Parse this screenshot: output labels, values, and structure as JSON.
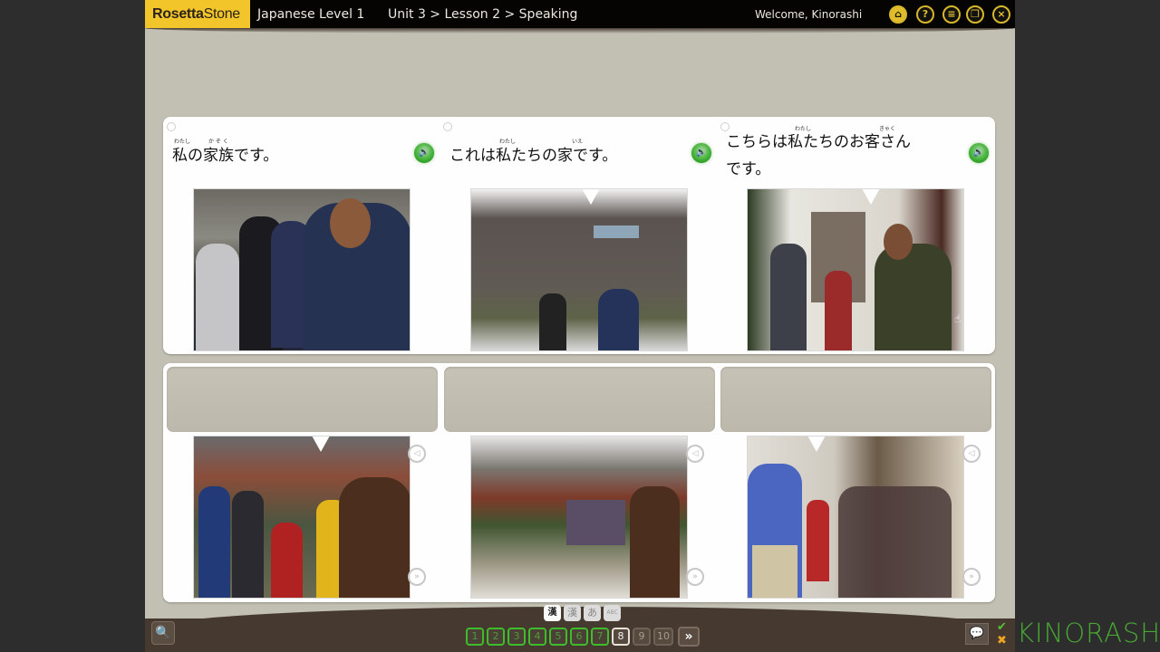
{
  "app": {
    "brand_bold": "Rosetta",
    "brand_thin": "Stone",
    "course_title": "Japanese Level 1",
    "breadcrumb": "Unit 3 > Lesson 2 > Speaking",
    "welcome": "Welcome, Kinorashi",
    "accent_color": "#f2c52a"
  },
  "toolbar_icons": [
    {
      "name": "home-icon",
      "glyph": "⌂"
    },
    {
      "name": "help-icon",
      "glyph": "?"
    },
    {
      "name": "menu-list-icon",
      "glyph": "≡"
    },
    {
      "name": "window-mode-icon",
      "glyph": "❐"
    },
    {
      "name": "close-icon",
      "glyph": "×"
    }
  ],
  "prompts": [
    {
      "sentence": "私の家族です。",
      "furigana": [
        {
          "text": "わたし",
          "over": "私"
        },
        {
          "text": "か ぞ く",
          "over": "家族"
        }
      ],
      "photo_description": "A family of four standing in front of a house; a man gestures toward the woman and children"
    },
    {
      "sentence": "これは私たちの家です。",
      "furigana": [
        {
          "text": "わたし",
          "over": "私"
        },
        {
          "text": "いえ",
          "over": "家"
        }
      ],
      "photo_description": "The family in front of a grey wooden house; the man gestures toward it"
    },
    {
      "sentence_line1": "こちらは私たちのお客さん",
      "sentence_line2": "です。",
      "furigana": [
        {
          "text": "わたし",
          "over": "私"
        },
        {
          "text": "きゃく",
          "over": "客"
        }
      ],
      "photo_description": "The man standing in a doorway welcoming a group of guests"
    }
  ],
  "answers": [
    {
      "slot": "",
      "photo_description": "A man in a brown jacket with his family in front of a brick house"
    },
    {
      "slot": "",
      "photo_description": "A man waving in front of a red brick house with the family on the lawn"
    },
    {
      "slot": "",
      "photo_description": "A man in a blue shirt inside a doorway with a group of guests"
    }
  ],
  "answer_controls": {
    "play": "◁",
    "next": "»"
  },
  "script_toggles": [
    {
      "label": "漢",
      "active": true
    },
    {
      "label": "漢",
      "active": false
    },
    {
      "label": "あ",
      "active": false
    },
    {
      "label": "ABC",
      "active": false
    }
  ],
  "pages": [
    {
      "label": "1",
      "state": "done"
    },
    {
      "label": "2",
      "state": "done"
    },
    {
      "label": "3",
      "state": "done"
    },
    {
      "label": "4",
      "state": "done"
    },
    {
      "label": "5",
      "state": "done"
    },
    {
      "label": "6",
      "state": "done"
    },
    {
      "label": "7",
      "state": "done"
    },
    {
      "label": "8",
      "state": "current"
    },
    {
      "label": "9",
      "state": "todo"
    },
    {
      "label": "10",
      "state": "todo"
    }
  ],
  "next_label": "»",
  "watermark": "KINORASHI",
  "status_colors": {
    "done": "#3ebc2c",
    "current": "#e6e2d8",
    "correct": "#56c238",
    "incorrect": "#f1a51f"
  }
}
